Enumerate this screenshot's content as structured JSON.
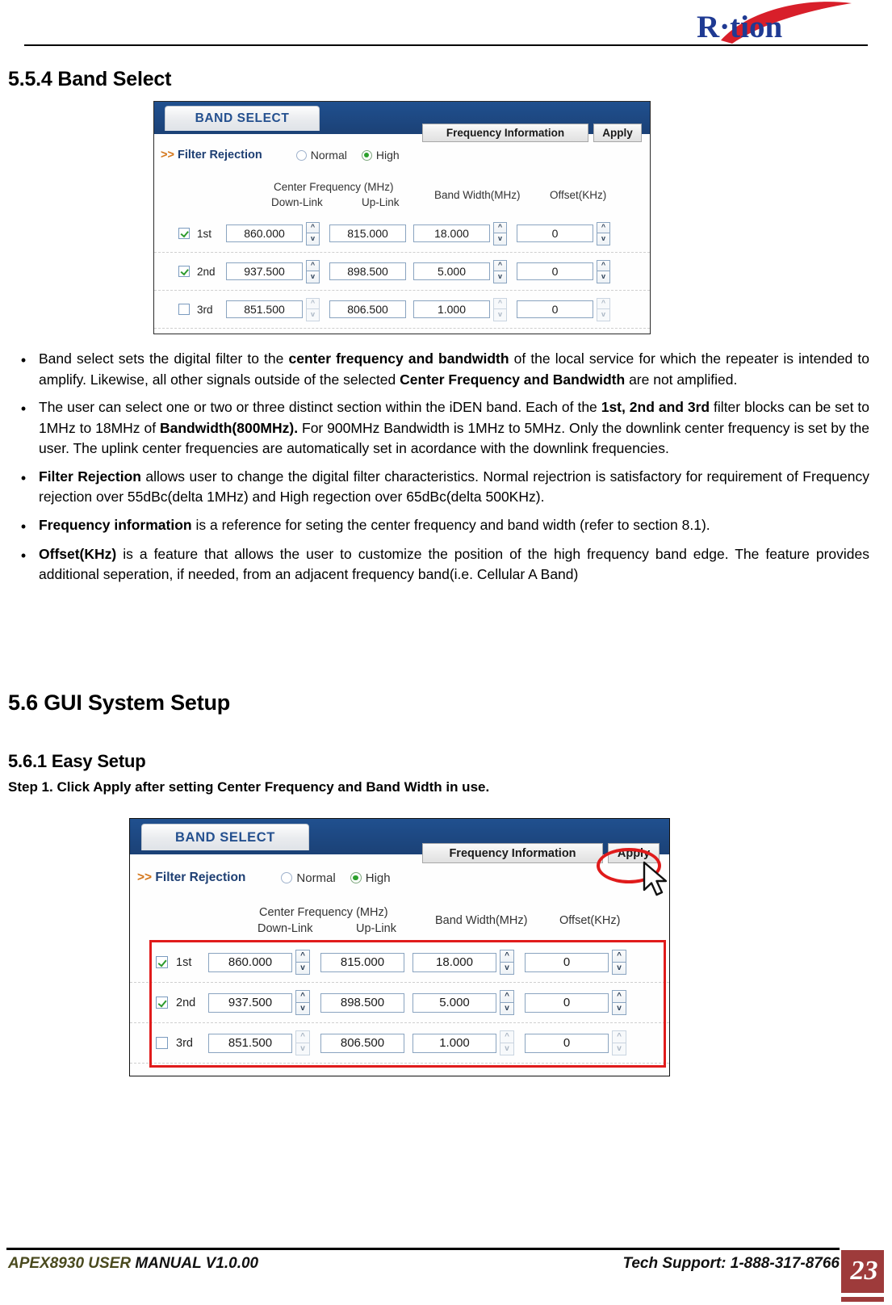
{
  "header": {
    "logo_text": "R·tion",
    "logo_colors": {
      "text": "#1f3a93",
      "swoosh": "#d81f2a"
    }
  },
  "headings": {
    "section_554": "5.5.4 Band Select",
    "section_56": "5.6   GUI System Setup",
    "section_561": "5.6.1 Easy Setup",
    "step1": "Step 1. Click Apply after setting Center Frequency and Band Width in use."
  },
  "bullets": [
    {
      "parts": [
        {
          "text": "Band select sets the digital filter to the ",
          "bold": false
        },
        {
          "text": "center frequency and bandwidth",
          "bold": true
        },
        {
          "text": " of the local service for which the repeater is intended to amplify. Likewise, all other signals outside of the selected ",
          "bold": false
        },
        {
          "text": "Center Frequency and Bandwidth",
          "bold": true
        },
        {
          "text": " are not amplified.",
          "bold": false
        }
      ]
    },
    {
      "parts": [
        {
          "text": "The user can select one or two or three distinct section within the iDEN band. Each of the ",
          "bold": false
        },
        {
          "text": "1st, 2nd and 3rd",
          "bold": true
        },
        {
          "text": " filter blocks can be set to 1MHz to 18MHz of ",
          "bold": false
        },
        {
          "text": "Bandwidth(800MHz).",
          "bold": true
        },
        {
          "text": " For 900MHz Bandwidth is 1MHz to 5MHz. Only the downlink center frequency is set by the user. The uplink center frequencies are automatically set in acordance with the downlink frequencies.",
          "bold": false
        }
      ]
    },
    {
      "parts": [
        {
          "text": "Filter Rejection",
          "bold": true
        },
        {
          "text": " allows user to change the digital filter characteristics. Normal rejectrion is satisfactory for requirement of Frequency rejection over 55dBc(delta 1MHz) and High regection over 65dBc(delta 500KHz).",
          "bold": false
        }
      ]
    },
    {
      "parts": [
        {
          "text": "Frequency information",
          "bold": true
        },
        {
          "text": " is a reference for seting the center frequency and band width (refer to section 8.1).",
          "bold": false
        }
      ]
    },
    {
      "parts": [
        {
          "text": "Offset(KHz)",
          "bold": true
        },
        {
          "text": " is a feature that allows the user to customize the position of the high frequency band edge. The feature provides additional seperation, if needed, from an adjacent frequency band(i.e. Cellular A Band)",
          "bold": false
        }
      ]
    }
  ],
  "gui": {
    "tab_label": "BAND SELECT",
    "buttons": {
      "frequency_information": "Frequency Information",
      "apply": "Apply"
    },
    "filter_rejection": {
      "arrows": ">>",
      "label": "Filter Rejection",
      "options": [
        {
          "label": "Normal",
          "selected": false
        },
        {
          "label": "High",
          "selected": true
        }
      ]
    },
    "column_headers": {
      "center_frequency": "Center Frequency (MHz)",
      "down_link": "Down-Link",
      "up_link": "Up-Link",
      "band_width": "Band Width(MHz)",
      "offset": "Offset(KHz)"
    },
    "rows": [
      {
        "label": "1st",
        "enabled": true,
        "down_link": "860.000",
        "up_link": "815.000",
        "band_width": "18.000",
        "offset": "0"
      },
      {
        "label": "2nd",
        "enabled": true,
        "down_link": "937.500",
        "up_link": "898.500",
        "band_width": "5.000",
        "offset": "0"
      },
      {
        "label": "3rd",
        "enabled": false,
        "down_link": "851.500",
        "up_link": "806.500",
        "band_width": "1.000",
        "offset": "0"
      }
    ],
    "annotation_color": "#e01b1b"
  },
  "footer": {
    "manual_prefix": "APEX8930 USER",
    "manual_suffix": " MANUAL V1.0.00",
    "tech_support": "Tech Support: 1-888-317-8766",
    "page_number": "23",
    "page_box_color": "#9e3b3b"
  }
}
